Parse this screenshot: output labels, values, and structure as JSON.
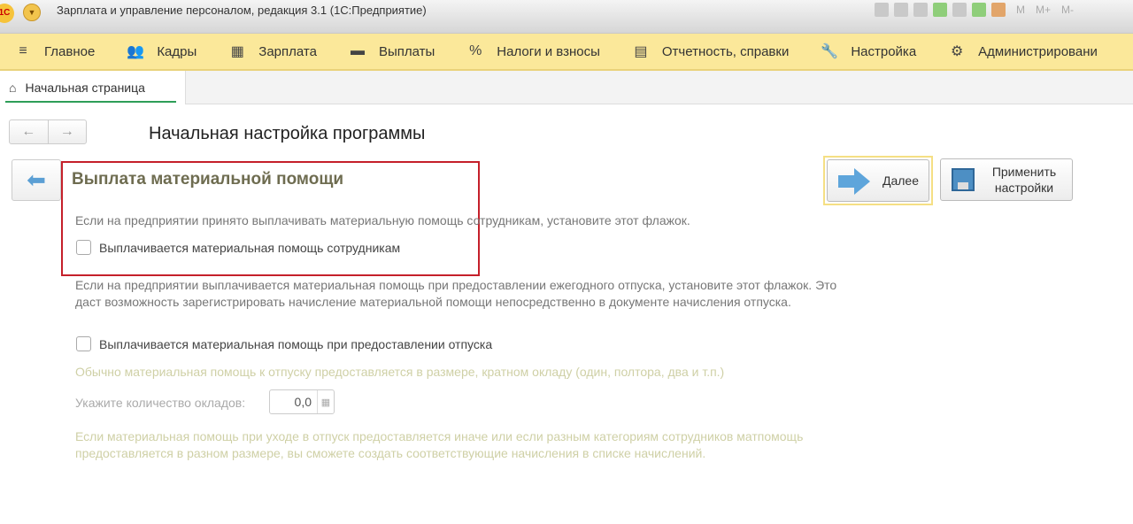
{
  "window": {
    "title": "Зарплата и управление персоналом, редакция 3.1  (1С:Предприятие)",
    "logo": "1С",
    "tools": [
      "save-icon",
      "print-icon",
      "preview-icon",
      "attach-icon",
      "mail-icon",
      "calculator-icon",
      "calendar-icon"
    ],
    "memory": [
      "M",
      "M+",
      "M-"
    ]
  },
  "menu": [
    {
      "label": "Главное",
      "icon": "≡"
    },
    {
      "label": "Кадры",
      "icon": "👥"
    },
    {
      "label": "Зарплата",
      "icon": "▦"
    },
    {
      "label": "Выплаты",
      "icon": "▬"
    },
    {
      "label": "Налоги и взносы",
      "icon": "%"
    },
    {
      "label": "Отчетность, справки",
      "icon": "▤"
    },
    {
      "label": "Настройка",
      "icon": "🔧"
    },
    {
      "label": "Администрировани",
      "icon": "⚙"
    }
  ],
  "tab": {
    "label": "Начальная страница"
  },
  "page": {
    "title": "Начальная настройка программы",
    "section": "Выплата материальной помощи",
    "intro": "Если на предприятии принято выплачивать материальную помощь сотрудникам, установите этот флажок.",
    "cb1": "Выплачивается материальная помощь сотрудникам",
    "para2": "Если на предприятии выплачивается материальная помощь при предоставлении ежегодного отпуска, установите этот флажок. Это даст возможность зарегистрировать начисление материальной помощи непосредственно в документе начисления отпуска.",
    "cb2": "Выплачивается материальная помощь при предоставлении отпуска",
    "hint": "Обычно материальная помощь к отпуску предоставляется в размере, кратном окладу (один, полтора, два и т.п.)",
    "count_label": "Укажите количество окладов:",
    "count_value": "0,0",
    "para3": "Если материальная помощь при уходе в отпуск предоставляется иначе или если разным категориям сотрудников матпомощь предоставляется в разном размере, вы сможете создать соответствующие начисления в списке начислений."
  },
  "buttons": {
    "next": "Далее",
    "apply": "Применить настройки"
  }
}
